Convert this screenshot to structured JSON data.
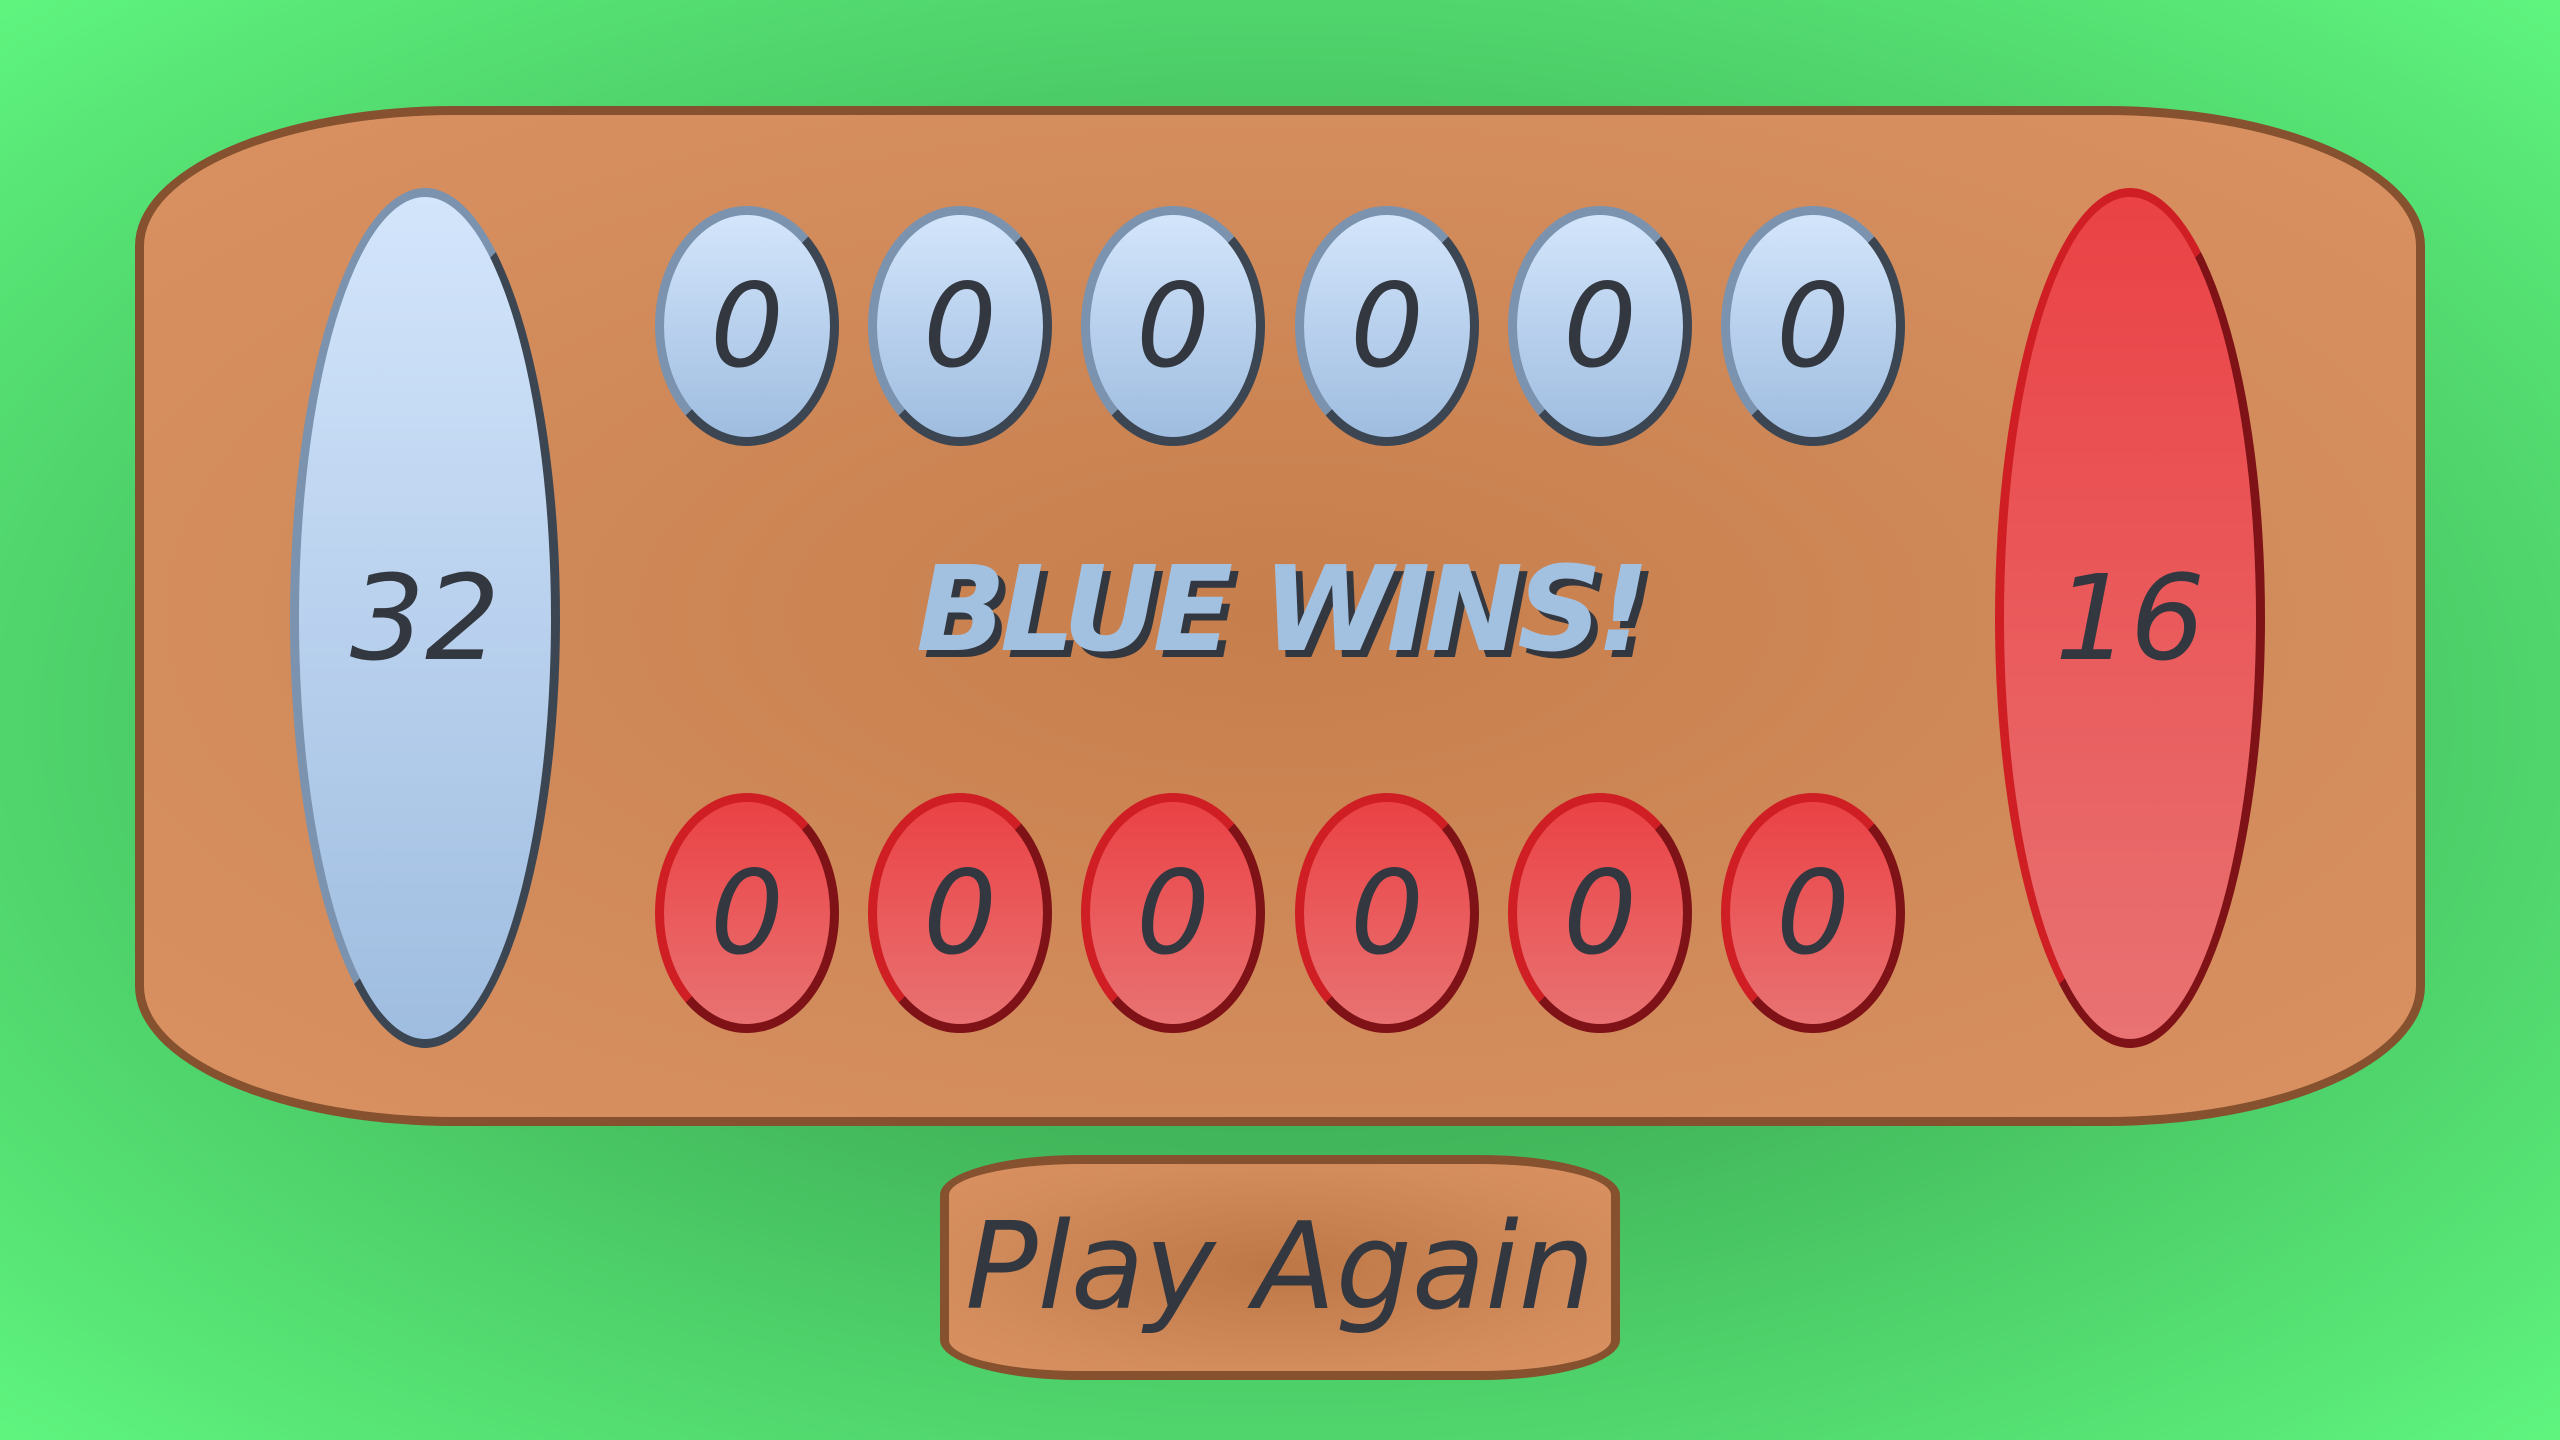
{
  "game": {
    "blue_store": "32",
    "red_store": "16",
    "blue_pits": [
      "0",
      "0",
      "0",
      "0",
      "0",
      "0"
    ],
    "red_pits": [
      "0",
      "0",
      "0",
      "0",
      "0",
      "0"
    ],
    "status": "BLUE WINS!",
    "play_again_label": "Play Again"
  },
  "colors": {
    "background": "#43b95c",
    "board": "#d38c5c",
    "board_border": "#85512e",
    "blue_piece": "#b8d1ee",
    "red_piece": "#ea4f51",
    "text": "#333840",
    "status_text": "#a2c1e1"
  }
}
